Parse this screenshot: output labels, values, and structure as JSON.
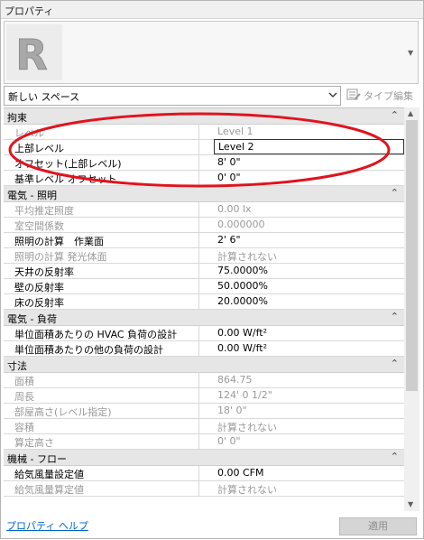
{
  "title": "プロパティ",
  "type_selector": {
    "value": "新しい スペース"
  },
  "type_edit": {
    "label": "タイプ編集"
  },
  "sections": [
    {
      "title": "拘束",
      "rows": [
        {
          "name": "レベル",
          "value": "Level 1",
          "readonly": true
        },
        {
          "name": "上部レベル",
          "value": "Level 2",
          "readonly": false,
          "active": true
        },
        {
          "name": "オフセット(上部レベル)",
          "value": "8'  0\"",
          "readonly": false
        },
        {
          "name": "基準レベル オフセット",
          "value": "0'  0\"",
          "readonly": false
        }
      ]
    },
    {
      "title": "電気 - 照明",
      "rows": [
        {
          "name": "平均推定照度",
          "value": "0.00 lx",
          "readonly": true
        },
        {
          "name": "室空間係数",
          "value": "0.000000",
          "readonly": true
        },
        {
          "name": "照明の計算　作業面",
          "value": "2'  6\"",
          "readonly": false
        },
        {
          "name": "照明の計算 発光体面",
          "value": "計算されない",
          "readonly": true
        },
        {
          "name": "天井の反射率",
          "value": "75.0000%",
          "readonly": false
        },
        {
          "name": "壁の反射率",
          "value": "50.0000%",
          "readonly": false
        },
        {
          "name": "床の反射率",
          "value": "20.0000%",
          "readonly": false
        }
      ]
    },
    {
      "title": "電気 - 負荷",
      "rows": [
        {
          "name": "単位面積あたりの HVAC 負荷の設計",
          "value": "0.00 W/ft²",
          "readonly": false
        },
        {
          "name": "単位面積あたりの他の負荷の設計",
          "value": "0.00 W/ft²",
          "readonly": false
        }
      ]
    },
    {
      "title": "寸法",
      "rows": [
        {
          "name": "面積",
          "value": "864.75",
          "readonly": true
        },
        {
          "name": "周長",
          "value": "124'  0 1/2\"",
          "readonly": true
        },
        {
          "name": "部屋高さ(レベル指定)",
          "value": "18'  0\"",
          "readonly": true
        },
        {
          "name": "容積",
          "value": "計算されない",
          "readonly": true
        },
        {
          "name": "算定高さ",
          "value": "0'  0\"",
          "readonly": true
        }
      ]
    },
    {
      "title": "機械 - フロー",
      "rows": [
        {
          "name": "給気風量設定値",
          "value": "0.00 CFM",
          "readonly": false
        },
        {
          "name": "給気風量算定値",
          "value": "計算されない",
          "readonly": true
        }
      ]
    }
  ],
  "footer": {
    "help_link": "プロパティ ヘルプ",
    "apply_label": "適用"
  },
  "colors": {
    "annotation": "#e0141e",
    "link": "#0066cc"
  }
}
